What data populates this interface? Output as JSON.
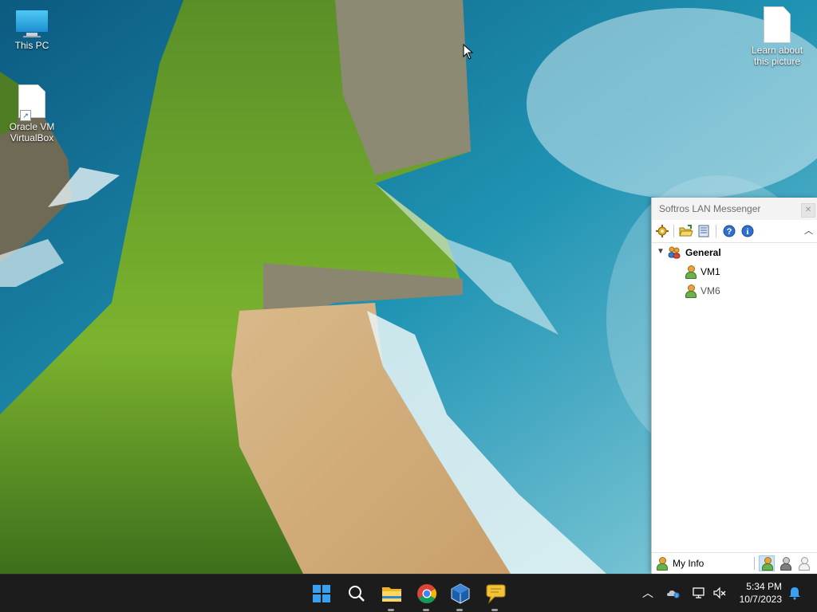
{
  "desktop": {
    "icons": [
      {
        "label": "This PC",
        "icon": "this-pc-icon"
      },
      {
        "label": "Oracle VM VirtualBox",
        "icon": "virtualbox-shortcut-icon"
      },
      {
        "label": "Learn about this picture",
        "icon": "document-icon"
      }
    ]
  },
  "messenger": {
    "title": "Softros LAN Messenger",
    "toolbar": [
      "settings-icon",
      "open-folder-icon",
      "message-log-icon",
      "help-icon",
      "info-icon"
    ],
    "tree": {
      "group": {
        "label": "General",
        "expanded": true
      },
      "users": [
        {
          "label": "VM1",
          "online": true
        },
        {
          "label": "VM6",
          "online": true
        }
      ]
    },
    "status_bar": {
      "my_info_label": "My Info",
      "status_buttons": [
        "available-status-icon",
        "away-status-icon",
        "offline-status-icon"
      ]
    }
  },
  "taskbar": {
    "apps": [
      "start-icon",
      "search-icon",
      "file-explorer-icon",
      "chrome-icon",
      "virtualbox-icon",
      "softros-messenger-icon"
    ],
    "tray": {
      "time": "5:34 PM",
      "date": "10/7/2023"
    }
  },
  "colors": {
    "taskbar": "#1c1c1c",
    "accent": "#0078d4"
  }
}
